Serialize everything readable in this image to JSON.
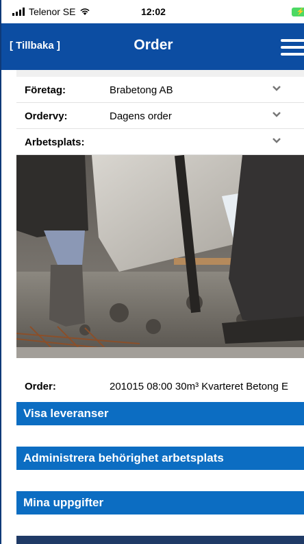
{
  "status": {
    "carrier": "Telenor SE",
    "time": "12:02"
  },
  "header": {
    "back_label": "[ Tillbaka ]",
    "title": "Order"
  },
  "form": {
    "company": {
      "label": "Företag:",
      "value": "Brabetong AB"
    },
    "order_view": {
      "label": "Ordervy:",
      "value": "Dagens order"
    },
    "workplace": {
      "label": "Arbetsplats:",
      "value": ""
    }
  },
  "order": {
    "label": "Order:",
    "value": "201015 08:00 30m³ Kvarteret Betong E"
  },
  "actions": {
    "deliveries": "Visa leveranser",
    "permissions": "Administrera behörighet arbetsplats",
    "my_info": "Mina uppgifter"
  },
  "colors": {
    "header": "#0c4da2",
    "button": "#0c6dc2",
    "dark_button": "#1f3a66"
  },
  "icons": {
    "menu": "hamburger-icon",
    "dropdown": "chevron-down-icon",
    "wifi": "wifi-icon",
    "signal": "signal-icon",
    "battery": "battery-charging-icon"
  }
}
